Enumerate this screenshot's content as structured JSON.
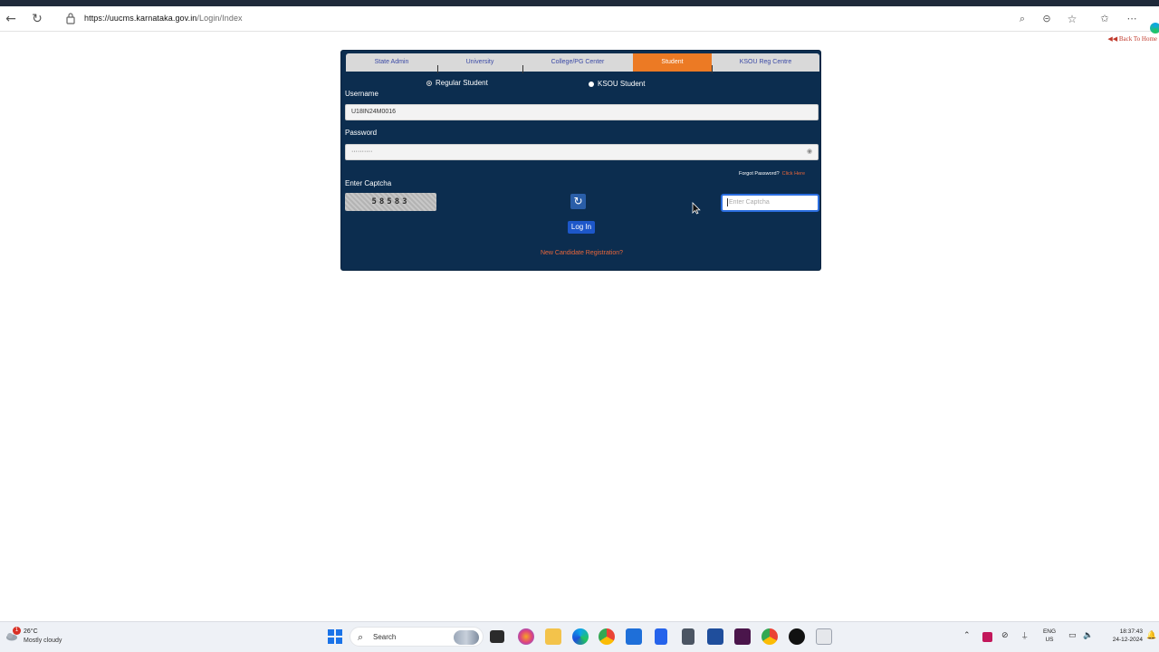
{
  "browser": {
    "url_host": "https://uucms.karnataka.gov.in",
    "url_path": "/Login/Index",
    "back_link": "Back To Home"
  },
  "login": {
    "tabs": [
      {
        "label": "State Admin"
      },
      {
        "label": "University"
      },
      {
        "label": "College/PG Center"
      },
      {
        "label": "Student"
      },
      {
        "label": "KSOU Reg Centre"
      }
    ],
    "active_tab": "Student",
    "radio_regular": "Regular Student",
    "radio_ksou": "KSOU Student",
    "username_label": "Username",
    "username_value": "U18IN24M0016",
    "password_label": "Password",
    "password_value": "··········",
    "forgot_text": "Forgot Password?",
    "forgot_link": "Click Here",
    "captcha_label": "Enter Captcha",
    "captcha_code": "58583",
    "captcha_placeholder": "Enter Captcha",
    "login_button": "Log In",
    "register_link": "New Candidate Registration?",
    "accent_color": "#ec7a24",
    "panel_color": "#0c2d4f"
  },
  "taskbar": {
    "weather_badge": "1",
    "temperature": "26°C",
    "condition": "Mostly cloudy",
    "search_label": "Search",
    "lang_line1": "ENG",
    "lang_line2": "US",
    "time": "18:37:43",
    "date": "24-12-2024"
  }
}
